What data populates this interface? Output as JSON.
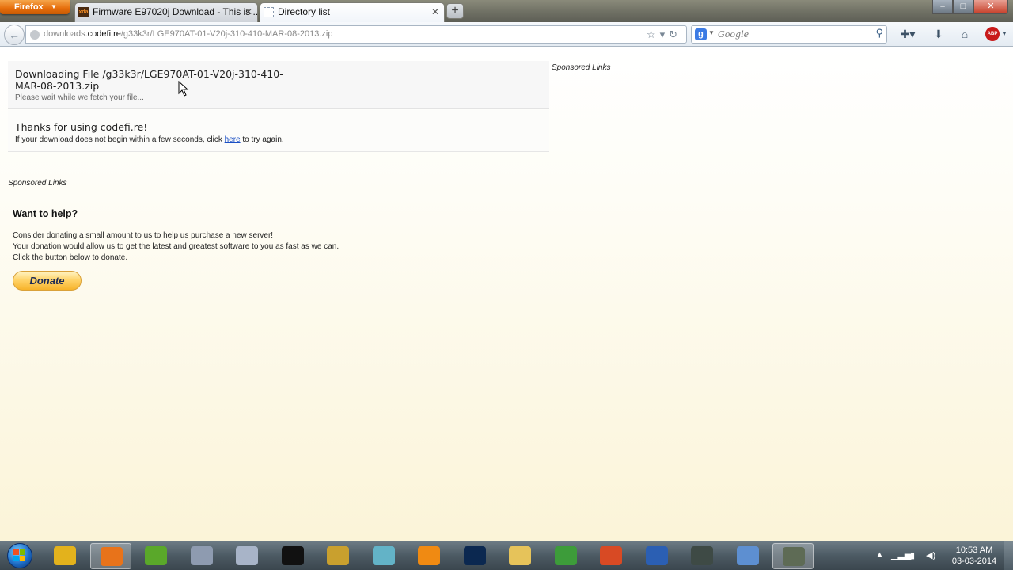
{
  "browser": {
    "menu_label": "Firefox",
    "tabs": [
      {
        "title": "Firmware E97020j Download - This is ...",
        "favicon_text": "xda"
      },
      {
        "title": "Directory list"
      }
    ],
    "url": {
      "prefix": "downloads.",
      "domain": "codefi.re",
      "path": "/g33k3r/LGE970AT-01-V20j-310-410-MAR-08-2013.zip"
    },
    "search": {
      "placeholder": "Google",
      "engine_letter": "g"
    }
  },
  "page": {
    "download": {
      "title": "Downloading File /g33k3r/LGE970AT-01-V20j-310-410-MAR-08-2013.zip",
      "wait_text": "Please wait while we fetch your file..."
    },
    "thanks": {
      "title": "Thanks for using codefi.re!",
      "text_before": "If your download does not begin within a few seconds, click ",
      "link": "here",
      "text_after": " to try again."
    },
    "sponsored_label": "Sponsored Links",
    "help": {
      "title": "Want to help?",
      "lines": [
        "Consider donating a small amount to us to help us purchase a new server!",
        "Your donation would allow us to get the latest and greatest software to you as fast as we can.",
        "Click the button below to donate."
      ],
      "donate_label": "Donate"
    }
  },
  "taskbar": {
    "apps": [
      {
        "name": "chrome",
        "color": "#e3b21c"
      },
      {
        "name": "firefox",
        "color": "#e8731a",
        "active": true
      },
      {
        "name": "utorrent",
        "color": "#5aa82a"
      },
      {
        "name": "app-gear",
        "color": "#8e9bb0"
      },
      {
        "name": "app-atom",
        "color": "#a8b4c8"
      },
      {
        "name": "cmd",
        "color": "#111111"
      },
      {
        "name": "app-pineapple",
        "color": "#c9a02e"
      },
      {
        "name": "app-frame",
        "color": "#63b3c7"
      },
      {
        "name": "vlc",
        "color": "#f08a12"
      },
      {
        "name": "photoshop",
        "color": "#0b2850"
      },
      {
        "name": "explorer",
        "color": "#e6c35a"
      },
      {
        "name": "app-globe",
        "color": "#3d9c3a"
      },
      {
        "name": "app-red",
        "color": "#d84a24"
      },
      {
        "name": "word",
        "color": "#2b5fb3"
      },
      {
        "name": "app-terminal",
        "color": "#3e4a45"
      },
      {
        "name": "app-wifi",
        "color": "#5d8fd1"
      },
      {
        "name": "app-console",
        "color": "#5e6b55",
        "active": true
      }
    ],
    "clock": {
      "time": "10:53 AM",
      "date": "03-03-2014"
    }
  }
}
